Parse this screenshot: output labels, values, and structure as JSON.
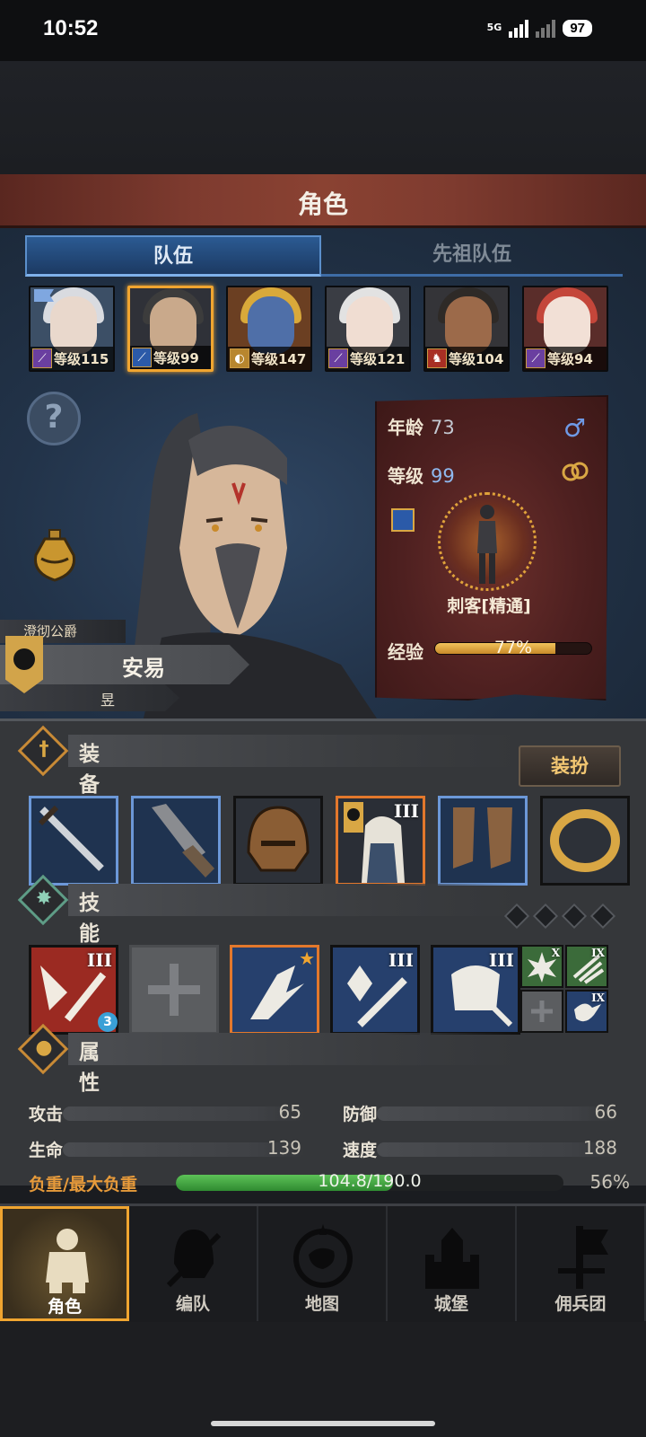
{
  "status": {
    "time": "10:52",
    "network": "5G",
    "battery": "97"
  },
  "title": "角色",
  "tabs": [
    {
      "label": "队伍",
      "active": true
    },
    {
      "label": "先祖队伍",
      "active": false
    }
  ],
  "team": [
    {
      "level_label": "等级115",
      "class_icon": "staff-icon",
      "selected": false
    },
    {
      "level_label": "等级99",
      "class_icon": "dagger-icon",
      "selected": true
    },
    {
      "level_label": "等级147",
      "class_icon": "moon-icon",
      "selected": false
    },
    {
      "level_label": "等级121",
      "class_icon": "staff-icon",
      "selected": false
    },
    {
      "level_label": "等级104",
      "class_icon": "beast-icon",
      "selected": false
    },
    {
      "level_label": "等级94",
      "class_icon": "staff-icon",
      "selected": false
    }
  ],
  "character": {
    "rank": "澄彻公爵",
    "name": "安易",
    "subtitle": "昱",
    "age_label": "年龄",
    "age": "73",
    "level_label": "等级",
    "level": "99",
    "gender_icon": "male-icon",
    "class_name": "刺客[精通]",
    "exp_label": "经验",
    "exp_text": "77%",
    "exp_fraction": 0.77
  },
  "equipment": {
    "title": "装备",
    "dress_button": "装扮",
    "slots": [
      {
        "icon": "dagger-icon"
      },
      {
        "icon": "gauntlet-icon"
      },
      {
        "icon": "helmet-icon"
      },
      {
        "icon": "armor-icon",
        "tier": "III"
      },
      {
        "icon": "boots-icon"
      },
      {
        "icon": "ring-icon"
      }
    ]
  },
  "skills": {
    "title": "技能",
    "main": [
      {
        "icon": "slash-skill-icon",
        "tier": "III",
        "badge": "3"
      },
      {
        "icon": "empty-slot-icon"
      },
      {
        "icon": "dash-skill-icon"
      },
      {
        "icon": "crystal-blade-icon",
        "tier": "III"
      },
      {
        "icon": "armor-skill-icon",
        "tier": "III"
      }
    ],
    "passive": [
      {
        "icon": "burst-icon",
        "tier": "X"
      },
      {
        "icon": "claw-icon",
        "tier": "IX"
      },
      {
        "icon": "empty-slot-icon"
      },
      {
        "icon": "bird-icon",
        "tier": "IX"
      }
    ]
  },
  "attributes": {
    "title": "属性",
    "stats": [
      {
        "label": "攻击",
        "value": "65"
      },
      {
        "label": "防御",
        "value": "66"
      },
      {
        "label": "生命",
        "value": "139"
      },
      {
        "label": "速度",
        "value": "188"
      }
    ],
    "load_label": "负重/最大负重",
    "load_text": "104.8/190.0",
    "load_pct": "56%",
    "load_fraction": 0.56
  },
  "nav": [
    {
      "label": "角色",
      "icon": "knight-icon",
      "active": true
    },
    {
      "label": "编队",
      "icon": "helmet-sword-icon",
      "active": false
    },
    {
      "label": "地图",
      "icon": "compass-map-icon",
      "active": false
    },
    {
      "label": "城堡",
      "icon": "castle-icon",
      "active": false
    },
    {
      "label": "佣兵团",
      "icon": "banner-icon",
      "active": false
    }
  ],
  "colors": {
    "accent": "#f0a530",
    "tab_blue": "#2b5a92",
    "title_red": "#7e3b2f",
    "exp_gold": "#f1c35b",
    "load_green": "#5dc257"
  }
}
